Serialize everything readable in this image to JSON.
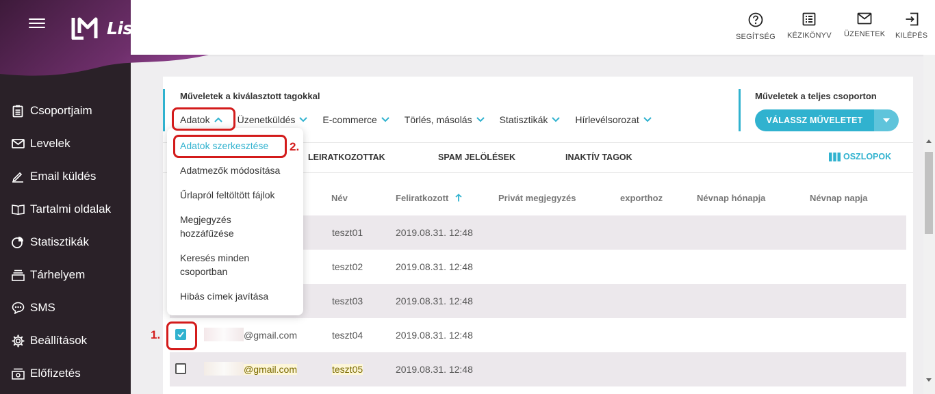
{
  "app": {
    "name": "ListaMester"
  },
  "header": {
    "buttons": [
      {
        "label": "SEGÍTSÉG",
        "icon": "help-circle-icon"
      },
      {
        "label": "KÉZIKÖNYV",
        "icon": "manual-list-icon"
      },
      {
        "label": "ÜZENETEK",
        "icon": "envelope-icon"
      },
      {
        "label": "KILÉPÉS",
        "icon": "logout-icon"
      }
    ]
  },
  "sidebar": {
    "items": [
      {
        "label": "Csoportjaim",
        "icon": "clipboard-icon"
      },
      {
        "label": "Levelek",
        "icon": "envelope-icon"
      },
      {
        "label": "Email küldés",
        "icon": "pencil-icon"
      },
      {
        "label": "Tartalmi oldalak",
        "icon": "book-icon"
      },
      {
        "label": "Statisztikák",
        "icon": "pie-chart-icon"
      },
      {
        "label": "Tárhelyem",
        "icon": "storage-icon"
      },
      {
        "label": "SMS",
        "icon": "chat-bubble-icon"
      },
      {
        "label": "Beállítások",
        "icon": "gear-icon"
      },
      {
        "label": "Előfizetés",
        "icon": "subscription-icon"
      }
    ]
  },
  "operations": {
    "selected_title": "Műveletek a kiválasztott tagokkal",
    "menu": [
      {
        "label": "Adatok",
        "open": true
      },
      {
        "label": "Üzenetküldés"
      },
      {
        "label": "E-commerce"
      },
      {
        "label": "Törlés, másolás"
      },
      {
        "label": "Statisztikák"
      },
      {
        "label": "Hírlevélsorozat"
      }
    ],
    "full_title": "Műveletek a teljes csoporton",
    "choose_label": "VÁLASSZ MŰVELETET"
  },
  "dropdown": {
    "items": [
      {
        "label": "Adatok szerkesztése",
        "active": true
      },
      {
        "label": "Adatmezők módosítása"
      },
      {
        "label": "Űrlapról feltöltött fájlok"
      },
      {
        "label_line1": "Megjegyzés",
        "label_line2": "hozzáfűzése"
      },
      {
        "label_line1": "Keresés minden",
        "label_line2": "csoportban"
      },
      {
        "label": "Hibás címek javítása"
      }
    ]
  },
  "tabs": [
    "LEIRATKOZOTTAK",
    "SPAM JELÖLÉSEK",
    "INAKTÍV TAGOK"
  ],
  "columns_button": "OSZLOPOK",
  "table": {
    "headers": [
      "Név",
      "Feliratkozott",
      "Privát megjegyzés",
      "exporthoz",
      "Névnap hónapja",
      "Névnap napja"
    ],
    "sort_icon": "arrow-up-icon",
    "rows": [
      {
        "email": "",
        "name": "teszt01",
        "subscribed": "2019.08.31. 12:48",
        "checked": false
      },
      {
        "email": "",
        "name": "teszt02",
        "subscribed": "2019.08.31. 12:48",
        "checked": false
      },
      {
        "email": "",
        "name": "teszt03",
        "subscribed": "2019.08.31. 12:48",
        "checked": false
      },
      {
        "email": "@gmail.com",
        "name": "teszt04",
        "subscribed": "2019.08.31. 12:48",
        "checked": true
      },
      {
        "email": "@gmail.com",
        "name": "teszt05",
        "subscribed": "2019.08.31. 12:48",
        "checked": false
      }
    ]
  },
  "annotations": {
    "step1": "1.",
    "step2": "2."
  },
  "colors": {
    "accent": "#30b2cf",
    "sidebar": "#2a2128",
    "brand_purple": "#8e3d8f",
    "annotation_red": "#d31b1b"
  }
}
